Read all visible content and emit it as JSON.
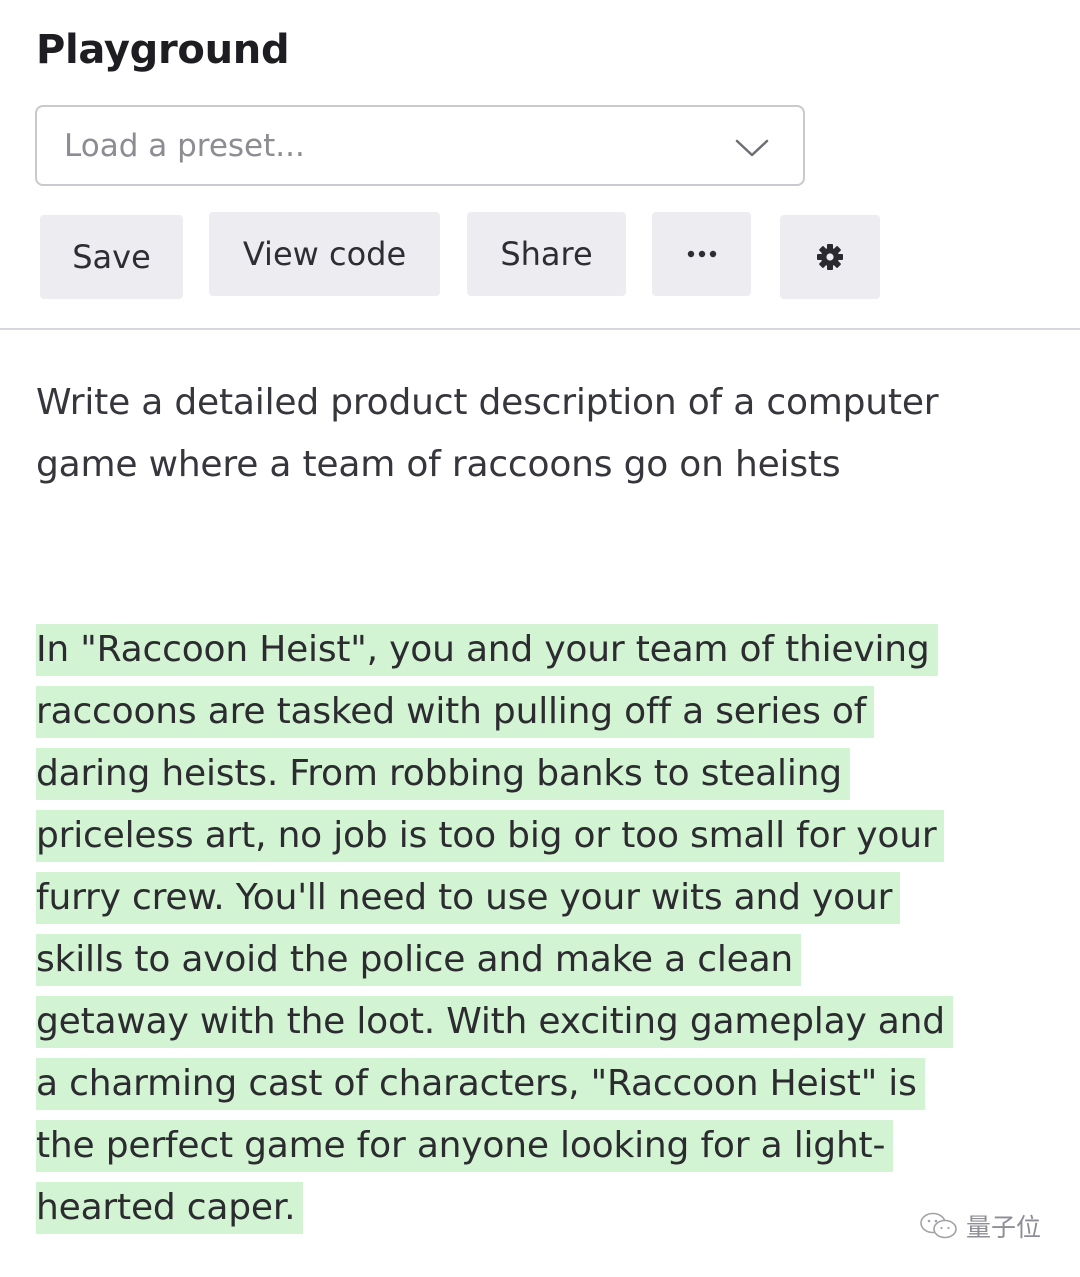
{
  "header": {
    "title": "Playground"
  },
  "preset": {
    "placeholder": "Load a preset..."
  },
  "toolbar": {
    "save_label": "Save",
    "view_code_label": "View code",
    "share_label": "Share",
    "more_icon": "ellipsis-icon",
    "settings_icon": "gear-icon"
  },
  "prompt": {
    "text": "Write a detailed product description of a computer game where a team of raccoons go on heists"
  },
  "completion": {
    "lines": [
      "In \"Raccoon Heist\", you and your team of thieving",
      "raccoons are tasked with pulling off a series of",
      "daring heists. From robbing banks to stealing",
      "priceless art, no job is too big or too small for your",
      "furry crew. You'll need to use your wits and your",
      "skills to avoid the police and make a clean",
      "getaway with the loot. With exciting gameplay and",
      "a charming cast of characters, \"Raccoon Heist\" is",
      "the perfect game for anyone looking for a light-",
      "hearted caper."
    ],
    "highlight_color": "#d2f4d3"
  },
  "watermark": {
    "text": "量子位"
  }
}
